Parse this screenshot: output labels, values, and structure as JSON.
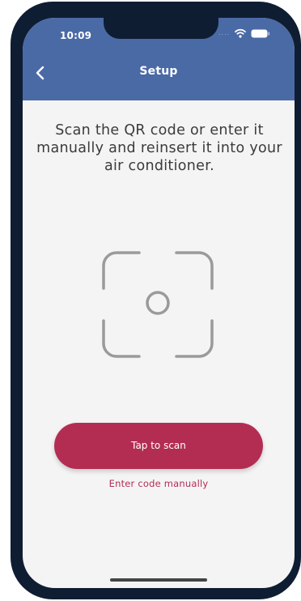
{
  "status_bar": {
    "time": "10:09",
    "signal": "....",
    "icons": [
      "wifi-icon",
      "battery-icon"
    ]
  },
  "header": {
    "title": "Setup",
    "back_icon": "chevron-left-icon"
  },
  "main": {
    "instruction": "Scan the QR code or enter it manually and reinsert it into your air conditioner.",
    "scan_icon": "qr-scan-frame-icon",
    "scan_button_label": "Tap to scan",
    "manual_link_label": "Enter code manually"
  },
  "colors": {
    "header": "#4a6aa6",
    "accent": "#b32d53",
    "background": "#f5f4f5",
    "frame": "#0f1d33"
  }
}
